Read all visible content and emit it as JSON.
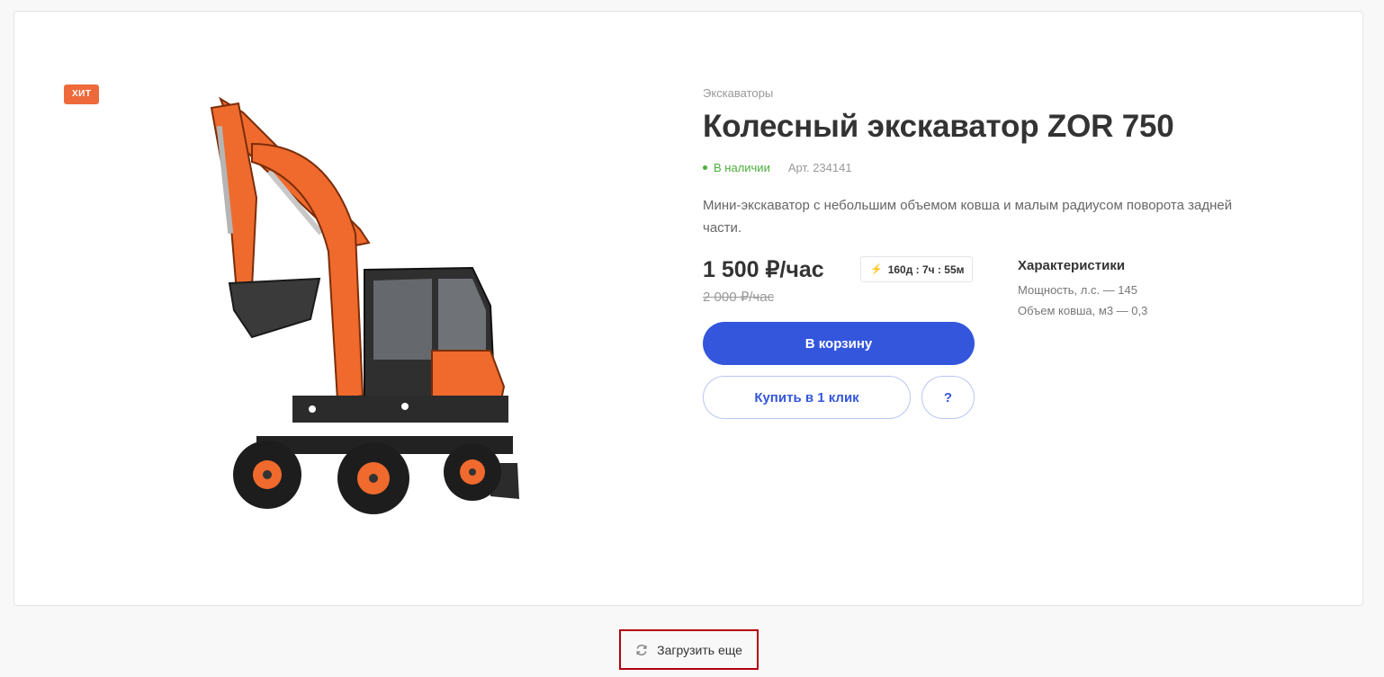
{
  "product": {
    "badge": "ХИТ",
    "category": "Экскаваторы",
    "title": "Колесный экскаватор ZOR 750",
    "stock": "В наличии",
    "sku": "Арт. 234141",
    "description": "Мини-экскаватор с небольшим объемом ковша и малым радиусом поворота задней части.",
    "price": "1 500 ₽/час",
    "old_price": "2 000 ₽/час",
    "timer": "160д : 7ч : 55м",
    "cart_label": "В корзину",
    "one_click_label": "Купить в 1 клик",
    "question_label": "?",
    "specs_title": "Характеристики",
    "specs": [
      "Мощность, л.с. — 145",
      "Объем ковша, м3 — 0,3"
    ],
    "image_alt": "excavator-photo"
  },
  "load_more_label": "Загрузить еще",
  "colors": {
    "accent": "#3456dd",
    "badge": "#ef6a3a",
    "stock": "#4cae3b",
    "highlight": "#b3000f"
  }
}
